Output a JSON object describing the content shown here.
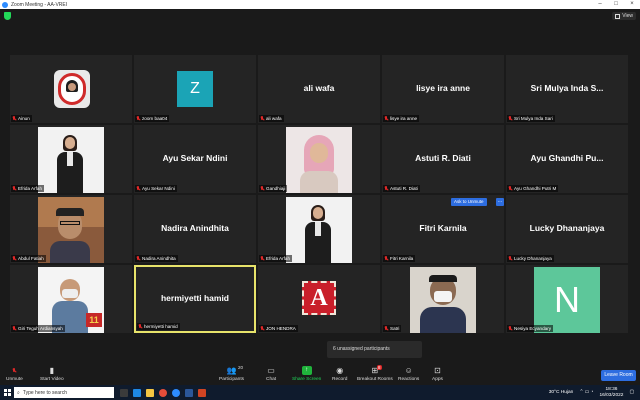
{
  "window": {
    "title": "Zoom Meeting - AA-VREI"
  },
  "topbar": {
    "view_label": "View"
  },
  "tiles": [
    {
      "display": "",
      "label": "Ainun"
    },
    {
      "display": "",
      "label": "zoom baa04",
      "letter": "Z",
      "letter_color": "#1ba4b6"
    },
    {
      "display": "ali wafa",
      "label": "ali wafa"
    },
    {
      "display": "lisye ira anne",
      "label": "lisye ira anne"
    },
    {
      "display": "Sri Mulya Inda S...",
      "label": "Sri Mulya Inda Sari"
    },
    {
      "display": "",
      "label": "Efrida Arfah"
    },
    {
      "display": "Ayu Sekar Ndini",
      "label": "Ayu Sekar Ndini"
    },
    {
      "display": "",
      "label": "Gandhiaji"
    },
    {
      "display": "Astuti R. Diati",
      "label": "Astuti R. Diati"
    },
    {
      "display": "Ayu Ghandhi Pu...",
      "label": "Ayu Ghandhi Putri M"
    },
    {
      "display": "",
      "label": "Abdul Fatiah"
    },
    {
      "display": "Nadira Anindhita",
      "label": "Nadira Anindhita"
    },
    {
      "display": "",
      "label": "Efrida Arfah"
    },
    {
      "display": "Fitri Karnila",
      "label": "Fitri Karnila"
    },
    {
      "display": "Lucky Dhananjaya",
      "label": "Lucky Dhananjaya"
    },
    {
      "display": "",
      "label": "Giri Teguh Ardiansyah"
    },
    {
      "display": "hermiyetti hamid",
      "label": "hermiyetti hamid"
    },
    {
      "display": "",
      "label": "JON HENDRA"
    },
    {
      "display": "",
      "label": "Satri"
    },
    {
      "display": "",
      "label": "Nesiya Ecyandary",
      "letter": "N",
      "letter_color": "#5dc79a"
    }
  ],
  "ask_unmute": "Ask to Unmute",
  "more_label": "...",
  "unassigned": "6 unassigned participants",
  "toolbar": {
    "unmute": "Unmute",
    "start_video": "Start Video",
    "participants": "Participants",
    "participants_count": "20",
    "chat": "Chat",
    "share_screen": "Share Screen",
    "record": "Record",
    "breakout": "Breakout Rooms",
    "breakout_badge": "8",
    "reactions": "Reactions",
    "apps": "Apps",
    "leave": "Leave Room"
  },
  "taskbar": {
    "search_placeholder": "Type here to search",
    "weather": "30°C  Hujan",
    "time": "18:36",
    "date": "16/03/2022"
  },
  "colors": {
    "accent_blue": "#2d6de0",
    "active_border": "#e7e36a",
    "share_green": "#20b43c",
    "muted_red": "#e02828"
  }
}
